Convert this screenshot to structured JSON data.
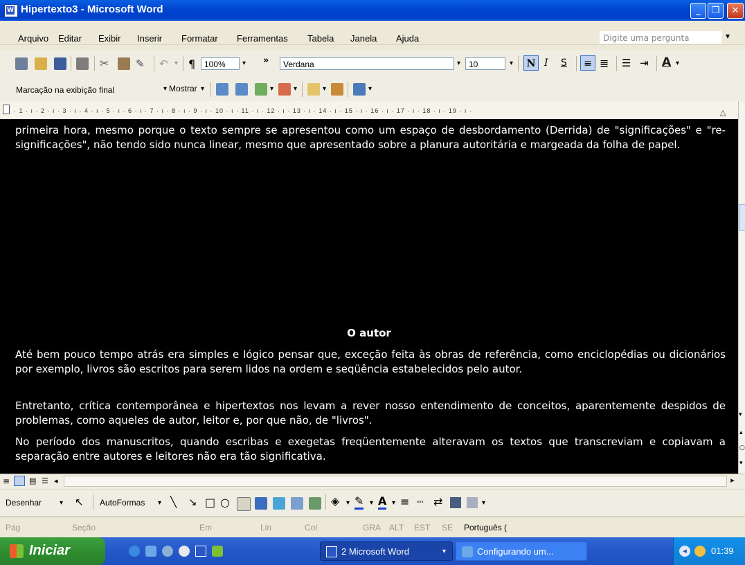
{
  "window": {
    "title": "Hipertexto3 - Microsoft Word"
  },
  "menu": [
    "Arquivo",
    "Editar",
    "Exibir",
    "Inserir",
    "Formatar",
    "Ferramentas",
    "Tabela",
    "Janela",
    "Ajuda"
  ],
  "ask_placeholder": "Digite uma pergunta",
  "toolbar": {
    "zoom": "100%",
    "font": "Verdana",
    "size": "10",
    "bold": "N",
    "italic": "I",
    "underline": "S"
  },
  "review": {
    "markup": "Marcação na exibição final",
    "show": "Mostrar"
  },
  "ruler": "· 1 · ı · 2 · ı · 3 · ı · 4 · ı · 5 · ı · 6 · ı · 7 · ı · 8 · ı · 9 · ı · 10 · ı · 11 · ı · 12 · ı · 13 · ı · 14 · ı · 15 · ı · 16 · ı · 17 · ı · 18 · ı · 19 · ı ·",
  "document": {
    "intro": "primeira hora, mesmo porque o texto sempre se apresentou como um espaço de desbordamento (Derrida) de \"significações\" e \"re-significações\", não tendo sido nunca linear, mesmo que apresentado sobre a planura autoritária e margeada da folha de papel.",
    "heading": "O autor",
    "p1": "Até bem pouco tempo atrás era simples e lógico pensar que, exceção feita às obras de referência, como enciclopédias ou dicionários por exemplo, livros são escritos para serem lidos na ordem e seqüência estabelecidos pelo autor.",
    "p2": "Entretanto, crítica contemporânea e hipertextos nos levam a rever nosso entendimento de conceitos, aparentemente despidos de problemas, como aqueles de autor, leitor e, por que não, de \"livros\".",
    "p3": "No período dos manuscritos, quando escribas e exegetas freqüentemente alteravam os textos que transcreviam e copiavam a separação entre autores e leitores não era tão significativa."
  },
  "draw": {
    "draw_label": "Desenhar",
    "autoshapes_label": "AutoFormas"
  },
  "status": {
    "pag": "Pág",
    "secao": "Seção",
    "em": "Em",
    "lin": "Lin",
    "col": "Col",
    "gra": "GRA",
    "alt": "ALT",
    "est": "EST",
    "se": "SE",
    "lang": "Português ("
  },
  "taskbar": {
    "start": "Iniciar",
    "task1": "2 Microsoft Word",
    "task2": "Configurando um...",
    "clock": "01:39"
  },
  "colors": {
    "titlebar": "#0045d0",
    "doc_bg": "#000000",
    "doc_text": "#ffffff",
    "taskbar": "#2457c9",
    "start": "#2d8a2d"
  }
}
